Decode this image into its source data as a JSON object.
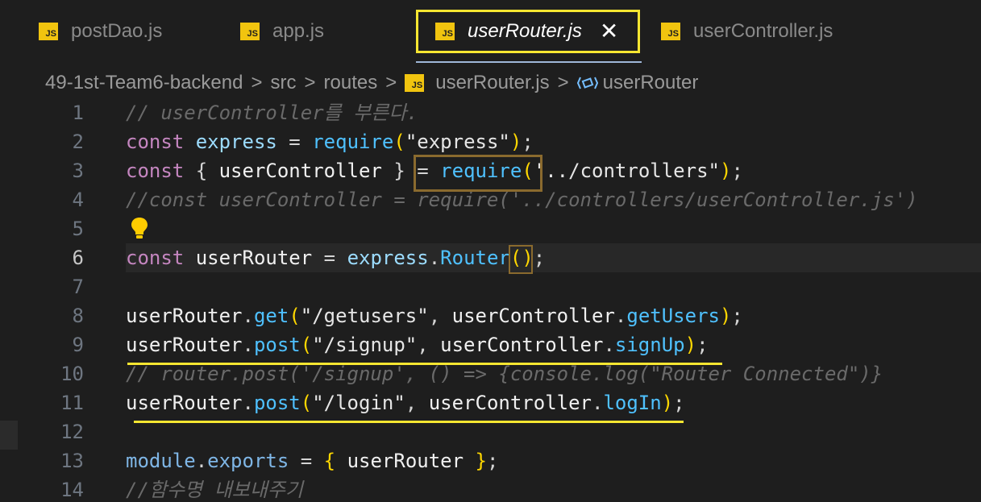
{
  "tabs": [
    {
      "label": "postDao.js",
      "icon": "js-file-icon",
      "active": false
    },
    {
      "label": "app.js",
      "icon": "js-file-icon",
      "active": false
    },
    {
      "label": "userRouter.js",
      "icon": "js-file-icon",
      "active": true
    },
    {
      "label": "userController.js",
      "icon": "js-file-icon",
      "active": false
    }
  ],
  "js_badge": "JS",
  "close_glyph": "✕",
  "breadcrumb": {
    "items": [
      "49-1st-Team6-backend",
      "src",
      "routes",
      "userRouter.js",
      "userRouter"
    ],
    "separator": ">"
  },
  "editor": {
    "current_line": 6,
    "line_numbers": [
      "1",
      "2",
      "3",
      "4",
      "5",
      "6",
      "7",
      "8",
      "9",
      "10",
      "11",
      "12",
      "13",
      "14"
    ],
    "lines": [
      [
        {
          "t": "// userController를 부른다.",
          "c": "cmt"
        }
      ],
      [
        {
          "t": "const ",
          "c": "kw"
        },
        {
          "t": "express",
          "c": "var"
        },
        {
          "t": " = ",
          "c": "punc"
        },
        {
          "t": "require",
          "c": "fnb"
        },
        {
          "t": "(",
          "c": "brace"
        },
        {
          "t": "\"express\"",
          "c": "strg"
        },
        {
          "t": ")",
          "c": "brace"
        },
        {
          "t": ";",
          "c": "punc"
        }
      ],
      [
        {
          "t": "const ",
          "c": "kw"
        },
        {
          "t": "{ ",
          "c": "punc"
        },
        {
          "t": "userController",
          "c": "white"
        },
        {
          "t": " } ",
          "c": "punc"
        },
        {
          "t": "= ",
          "c": "punc"
        },
        {
          "t": "require",
          "c": "fnb"
        },
        {
          "t": "(",
          "c": "brace"
        },
        {
          "t": "'",
          "c": "strg"
        },
        {
          "t": "../controllers\"",
          "c": "strg"
        },
        {
          "t": ")",
          "c": "brace"
        },
        {
          "t": ";",
          "c": "punc"
        }
      ],
      [
        {
          "t": "//const userController = require('../controllers/userController.js')",
          "c": "cmt"
        }
      ],
      [],
      [
        {
          "t": "const ",
          "c": "kw"
        },
        {
          "t": "userRouter",
          "c": "white"
        },
        {
          "t": " = ",
          "c": "punc"
        },
        {
          "t": "express",
          "c": "var"
        },
        {
          "t": ".",
          "c": "punc"
        },
        {
          "t": "Router",
          "c": "fnb"
        },
        {
          "t": "()",
          "c": "brace"
        },
        {
          "t": ";",
          "c": "punc"
        }
      ],
      [],
      [
        {
          "t": "userRouter",
          "c": "white"
        },
        {
          "t": ".",
          "c": "punc"
        },
        {
          "t": "get",
          "c": "fnb"
        },
        {
          "t": "(",
          "c": "brace"
        },
        {
          "t": "\"/getusers\"",
          "c": "strg"
        },
        {
          "t": ", ",
          "c": "punc"
        },
        {
          "t": "userController",
          "c": "white"
        },
        {
          "t": ".",
          "c": "punc"
        },
        {
          "t": "getUsers",
          "c": "fnb"
        },
        {
          "t": ")",
          "c": "brace"
        },
        {
          "t": ";",
          "c": "punc"
        }
      ],
      [
        {
          "t": "userRouter",
          "c": "white"
        },
        {
          "t": ".",
          "c": "punc"
        },
        {
          "t": "post",
          "c": "fnb"
        },
        {
          "t": "(",
          "c": "brace"
        },
        {
          "t": "\"/signup\"",
          "c": "strg"
        },
        {
          "t": ", ",
          "c": "punc"
        },
        {
          "t": "userController",
          "c": "white"
        },
        {
          "t": ".",
          "c": "punc"
        },
        {
          "t": "signUp",
          "c": "fnb"
        },
        {
          "t": ")",
          "c": "brace"
        },
        {
          "t": ";",
          "c": "punc"
        }
      ],
      [
        {
          "t": "// router.post('/signup', () => {console.log(\"Router Connected\")}",
          "c": "cmt"
        }
      ],
      [
        {
          "t": "userRouter",
          "c": "white"
        },
        {
          "t": ".",
          "c": "punc"
        },
        {
          "t": "post",
          "c": "fnb"
        },
        {
          "t": "(",
          "c": "brace"
        },
        {
          "t": "\"/login\"",
          "c": "strg"
        },
        {
          "t": ", ",
          "c": "punc"
        },
        {
          "t": "userController",
          "c": "white"
        },
        {
          "t": ".",
          "c": "punc"
        },
        {
          "t": "logIn",
          "c": "fnb"
        },
        {
          "t": ")",
          "c": "brace"
        },
        {
          "t": ";",
          "c": "punc"
        }
      ],
      [],
      [
        {
          "t": "module",
          "c": "prop"
        },
        {
          "t": ".",
          "c": "punc"
        },
        {
          "t": "exports",
          "c": "prop"
        },
        {
          "t": " = ",
          "c": "punc"
        },
        {
          "t": "{ ",
          "c": "brace"
        },
        {
          "t": "userRouter",
          "c": "white"
        },
        {
          "t": " }",
          "c": "brace"
        },
        {
          "t": ";",
          "c": "punc"
        }
      ],
      [
        {
          "t": "//함수명 내보내주기",
          "c": "cmt"
        }
      ]
    ]
  },
  "colors": {
    "background": "#1e1e1e",
    "tab_highlight": "#f7e631",
    "tab_underline": "#9fb7d8",
    "annotation_box": "#8a6a2e",
    "js_icon": "#f1c40f",
    "keyword": "#c586c0",
    "function": "#4fc1ff",
    "comment": "#6a6a6a"
  }
}
